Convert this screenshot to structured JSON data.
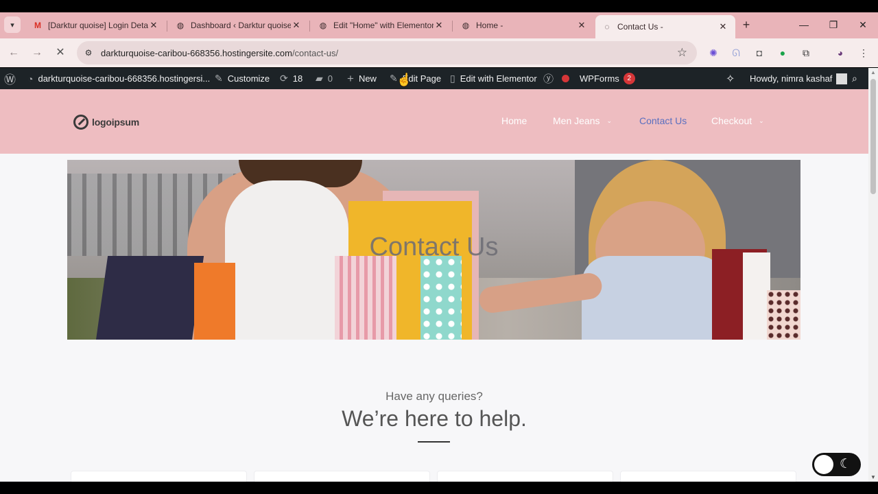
{
  "browser": {
    "tabs": [
      {
        "label": "[Darktur quoise] Login Details",
        "favicon": "gmail-icon"
      },
      {
        "label": "Dashboard ‹ Darktur quoise",
        "favicon": "globe-icon"
      },
      {
        "label": "Edit \"Home\" with Elementor",
        "favicon": "globe-icon"
      },
      {
        "label": "Home -",
        "favicon": "globe-icon"
      },
      {
        "label": "Contact Us -",
        "favicon": "loading-icon"
      }
    ],
    "address": {
      "host": "darkturquoise-caribou-668356.hostingersite.com",
      "path": "/contact-us/"
    },
    "colors": {
      "tabstrip": "#e9b4b9",
      "toolbar": "#f6ecec"
    }
  },
  "adminbar": {
    "site": "darkturquoise-caribou-668356.hostingersi...",
    "customize": "Customize",
    "updates": "18",
    "comments": "0",
    "new": "New",
    "edit_page": "Edit Page",
    "edit_elementor": "Edit with Elementor",
    "wpforms": "WPForms",
    "wpforms_badge": "2",
    "howdy": "Howdy, nimra kashaf"
  },
  "site": {
    "logo": "logoipsum",
    "nav": [
      {
        "label": "Home"
      },
      {
        "label": "Men Jeans"
      },
      {
        "label": "Contact Us"
      },
      {
        "label": "Checkout"
      }
    ],
    "hero_title": "Contact Us",
    "queries": "Have any queries?",
    "help": "We’re here to help.",
    "colors": {
      "header": "#eebdc1",
      "current_nav": "#5a6fc0"
    }
  }
}
